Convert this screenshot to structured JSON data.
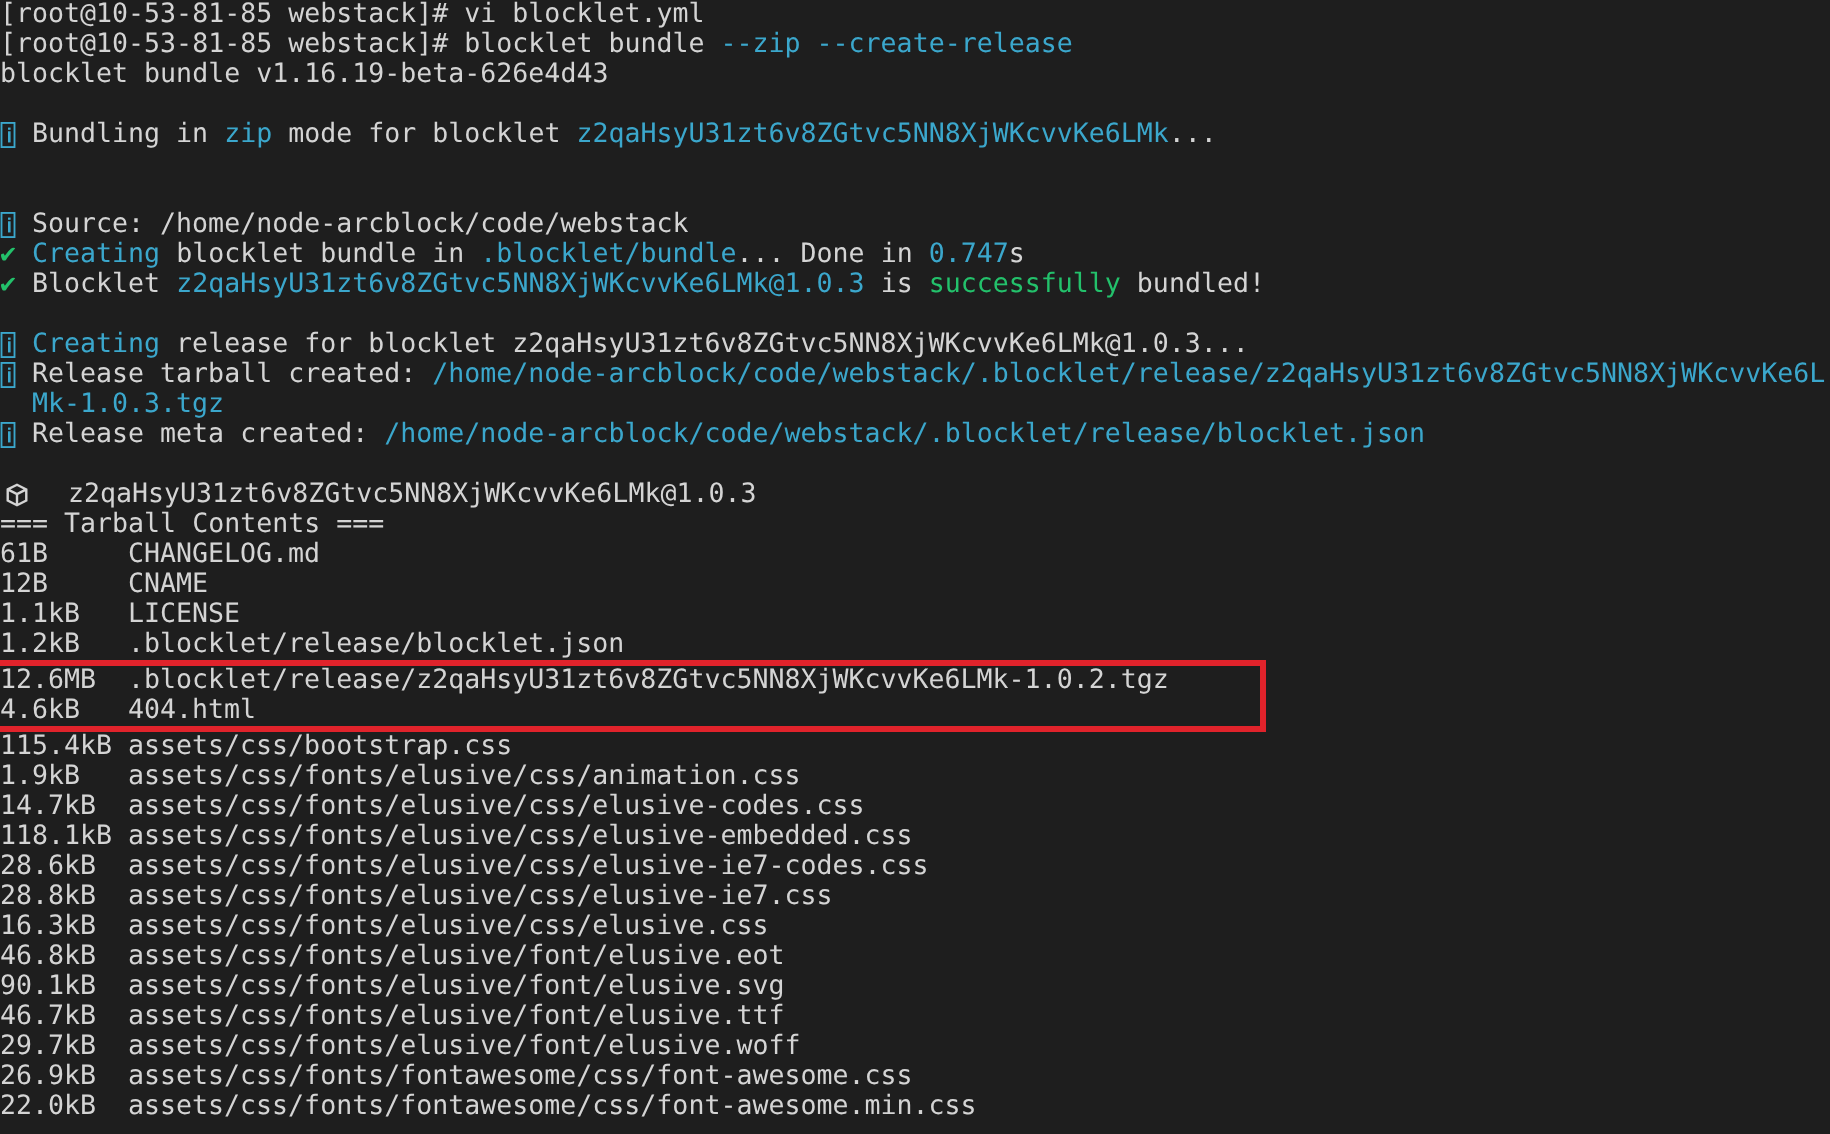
{
  "terminal": {
    "lines": [
      {
        "kind": "plain",
        "segments": [
          {
            "text": "[root@10-53-81-85 webstack]# vi blocklet.yml",
            "color": "#d4d4d4"
          }
        ]
      },
      {
        "kind": "plain",
        "segments": [
          {
            "text": "[root@10-53-81-85 webstack]# blocklet bundle ",
            "color": "#d4d4d4"
          },
          {
            "text": "--zip --create-release",
            "color": "#3ba7cc"
          }
        ]
      },
      {
        "kind": "plain",
        "segments": [
          {
            "text": "blocklet bundle v1.16.19-beta-626e4d43",
            "color": "#d4d4d4"
          }
        ]
      },
      {
        "kind": "blank"
      },
      {
        "kind": "info",
        "segments": [
          {
            "text": "Bundling in ",
            "color": "#d4d4d4"
          },
          {
            "text": "zip",
            "color": "#3ba7cc"
          },
          {
            "text": " mode for blocklet ",
            "color": "#d4d4d4"
          },
          {
            "text": "z2qaHsyU31zt6v8ZGtvc5NN8XjWKcvvKe6LMk",
            "color": "#3ba7cc"
          },
          {
            "text": "...",
            "color": "#d4d4d4"
          }
        ]
      },
      {
        "kind": "blank"
      },
      {
        "kind": "blank"
      },
      {
        "kind": "info",
        "segments": [
          {
            "text": "Source: /home/node-arcblock/code/webstack",
            "color": "#d4d4d4"
          }
        ]
      },
      {
        "kind": "plain",
        "segments": [
          {
            "text": "✔ ",
            "color": "#23c16b"
          },
          {
            "text": "Creating",
            "color": "#3ba7cc"
          },
          {
            "text": " blocklet bundle in ",
            "color": "#d4d4d4"
          },
          {
            "text": ".blocklet/bundle",
            "color": "#3ba7cc"
          },
          {
            "text": "... Done in ",
            "color": "#d4d4d4"
          },
          {
            "text": "0.747",
            "color": "#3ba7cc"
          },
          {
            "text": "s",
            "color": "#d4d4d4"
          }
        ]
      },
      {
        "kind": "plain",
        "segments": [
          {
            "text": "✔ ",
            "color": "#23c16b"
          },
          {
            "text": "Blocklet ",
            "color": "#d4d4d4"
          },
          {
            "text": "z2qaHsyU31zt6v8ZGtvc5NN8XjWKcvvKe6LMk@1.0.3",
            "color": "#3ba7cc"
          },
          {
            "text": " is ",
            "color": "#d4d4d4"
          },
          {
            "text": "successfully",
            "color": "#23c16b"
          },
          {
            "text": " bundled!",
            "color": "#d4d4d4"
          }
        ]
      },
      {
        "kind": "blank"
      },
      {
        "kind": "info",
        "segments": [
          {
            "text": "Creating",
            "color": "#3ba7cc"
          },
          {
            "text": " release for blocklet z2qaHsyU31zt6v8ZGtvc5NN8XjWKcvvKe6LMk@1.0.3...",
            "color": "#d4d4d4"
          }
        ]
      },
      {
        "kind": "info",
        "segments": [
          {
            "text": "Release tarball created: ",
            "color": "#d4d4d4"
          },
          {
            "text": "/home/node-arcblock/code/webstack/.blocklet/release/z2qaHsyU31zt6v8ZGtvc5NN8XjWKcvvKe6LMk-1.0.3.tgz",
            "color": "#3ba7cc"
          }
        ]
      },
      {
        "kind": "info",
        "segments": [
          {
            "text": "Release meta created: ",
            "color": "#d4d4d4"
          },
          {
            "text": "/home/node-arcblock/code/webstack/.blocklet/release/blocklet.json",
            "color": "#3ba7cc"
          }
        ]
      },
      {
        "kind": "blank"
      },
      {
        "kind": "package",
        "segments": [
          {
            "text": "z2qaHsyU31zt6v8ZGtvc5NN8XjWKcvvKe6LMk@1.0.3",
            "color": "#d4d4d4"
          }
        ]
      },
      {
        "kind": "plain",
        "segments": [
          {
            "text": "=== Tarball Contents ===",
            "color": "#d4d4d4"
          }
        ]
      }
    ],
    "files": [
      {
        "size": "61B",
        "path": "CHANGELOG.md",
        "highlighted": false
      },
      {
        "size": "12B",
        "path": "CNAME",
        "highlighted": false
      },
      {
        "size": "1.1kB",
        "path": "LICENSE",
        "highlighted": false
      },
      {
        "size": "1.2kB",
        "path": ".blocklet/release/blocklet.json",
        "highlighted": false
      },
      {
        "size": "12.6MB",
        "path": ".blocklet/release/z2qaHsyU31zt6v8ZGtvc5NN8XjWKcvvKe6LMk-1.0.2.tgz",
        "highlighted": true
      },
      {
        "size": "4.6kB",
        "path": "404.html",
        "highlighted": true
      },
      {
        "size": "115.4kB",
        "path": "assets/css/bootstrap.css",
        "highlighted": false
      },
      {
        "size": "1.9kB",
        "path": "assets/css/fonts/elusive/css/animation.css",
        "highlighted": false
      },
      {
        "size": "14.7kB",
        "path": "assets/css/fonts/elusive/css/elusive-codes.css",
        "highlighted": false
      },
      {
        "size": "118.1kB",
        "path": "assets/css/fonts/elusive/css/elusive-embedded.css",
        "highlighted": false
      },
      {
        "size": "28.6kB",
        "path": "assets/css/fonts/elusive/css/elusive-ie7-codes.css",
        "highlighted": false
      },
      {
        "size": "28.8kB",
        "path": "assets/css/fonts/elusive/css/elusive-ie7.css",
        "highlighted": false
      },
      {
        "size": "16.3kB",
        "path": "assets/css/fonts/elusive/css/elusive.css",
        "highlighted": false
      },
      {
        "size": "46.8kB",
        "path": "assets/css/fonts/elusive/font/elusive.eot",
        "highlighted": false
      },
      {
        "size": "90.1kB",
        "path": "assets/css/fonts/elusive/font/elusive.svg",
        "highlighted": false
      },
      {
        "size": "46.7kB",
        "path": "assets/css/fonts/elusive/font/elusive.ttf",
        "highlighted": false
      },
      {
        "size": "29.7kB",
        "path": "assets/css/fonts/elusive/font/elusive.woff",
        "highlighted": false
      },
      {
        "size": "26.9kB",
        "path": "assets/css/fonts/fontawesome/css/font-awesome.css",
        "highlighted": false
      },
      {
        "size": "22.0kB",
        "path": "assets/css/fonts/fontawesome/css/font-awesome.min.css",
        "highlighted": false
      }
    ]
  }
}
